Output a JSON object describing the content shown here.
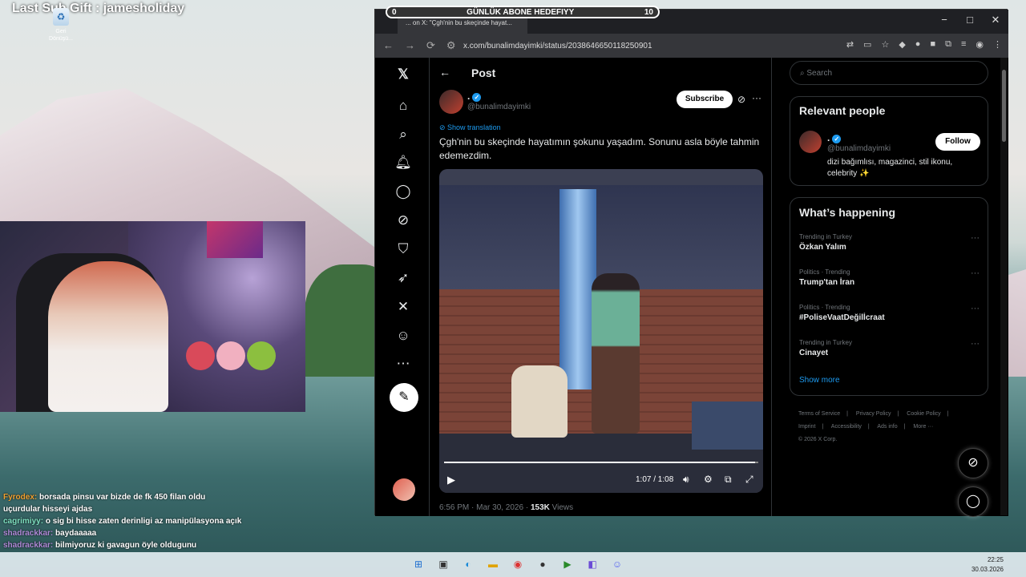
{
  "overlay": {
    "last_sub": "Last Sub Gift : jamesholiday",
    "goal_title": "GÜNLÜK ABONE HEDEFIYY",
    "goal_current": "0",
    "goal_target": "10"
  },
  "desktop": {
    "recycle_bin_label": "Geri Dönüşü..."
  },
  "chat": [
    {
      "user": "Fyrodex:",
      "text": "borsada pinsu var bizde de fk 450 filan oldu uçurdular hisseyi ajdas"
    },
    {
      "user": "cagrimiyy:",
      "text": "o sig bi hisse zaten derinligi az manipülasyona açık"
    },
    {
      "user": "shadrackkar:",
      "text": "baydaaaaa"
    },
    {
      "user": "shadrackkar:",
      "text": "bilmiyoruz ki gavagun öyle oldugunu"
    }
  ],
  "browser": {
    "tab_title": "... on X: \"Çgh'nin bu skeçinde hayat...",
    "url": "x.com/bunalimdayimki/status/2038646650118250901"
  },
  "post": {
    "header": "Post",
    "author_name": ".",
    "author_handle": "@bunalimdayimki",
    "subscribe_label": "Subscribe",
    "show_translation": "Show translation",
    "text": "Çgh'nin bu skeçinde hayatımın şokunu yaşadım. Sonunu asla böyle tahmin edemezdim.",
    "video_time": "1:07 / 1:08",
    "video_progress": 0.99,
    "timestamp": "6:56 PM · Mar 30, 2026 · ",
    "views_count": "153K",
    "views_label": " Views"
  },
  "sidebar": {
    "search_placeholder": "Search",
    "relevant_title": "Relevant people",
    "person_name": ".",
    "person_handle": "@bunalimdayimki",
    "person_bio": "dizi bağımlısı, magazinci, stil ikonu, celebrity ✨",
    "follow_label": "Follow",
    "happening_title": "What’s happening",
    "trends": [
      {
        "category": "Trending in Turkey",
        "name": "Özkan Yalım"
      },
      {
        "category": "Politics · Trending",
        "name": "Trump'tan İran"
      },
      {
        "category": "Politics · Trending",
        "name": "#PoliseVaatDeğilİcraat"
      },
      {
        "category": "Trending in Turkey",
        "name": "Cinayet"
      }
    ],
    "show_more": "Show more",
    "footer": [
      "Terms of Service",
      "|",
      "Privacy Policy",
      "|",
      "Cookie Policy",
      "|",
      "Imprint",
      "|",
      "Accessibility",
      "|",
      "Ads info",
      "|",
      "More ···",
      "© 2026 X Corp."
    ]
  },
  "taskbar": {
    "time": "22:25",
    "date": "30.03.2026"
  },
  "colors": {
    "x_blue": "#1d9bf0",
    "x_bg": "#000000",
    "text": "#e7e9ea"
  }
}
